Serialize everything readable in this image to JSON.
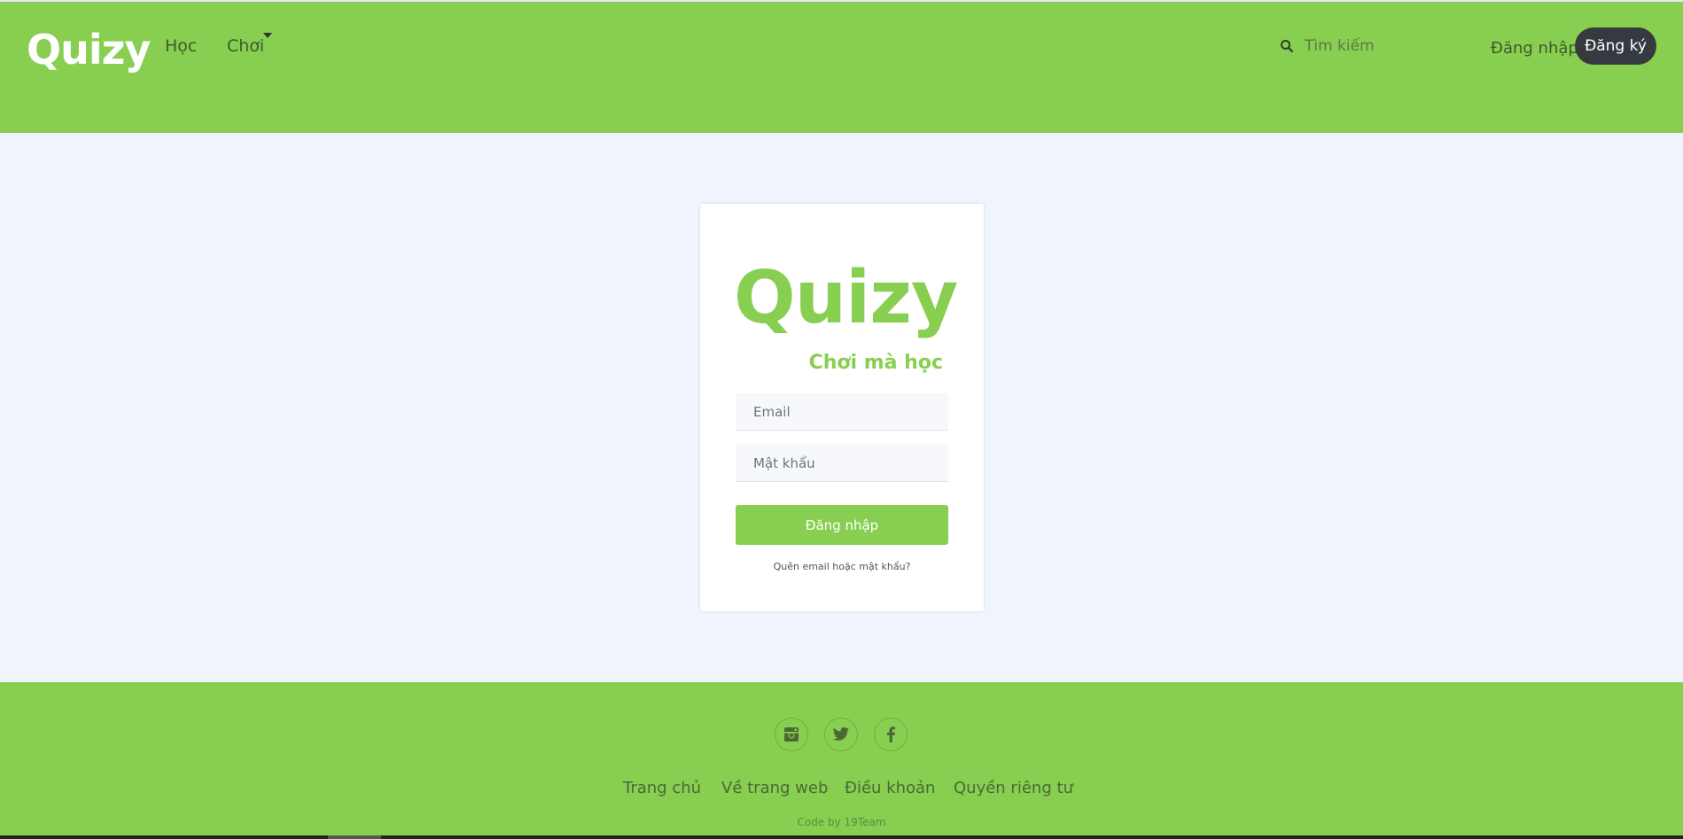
{
  "header": {
    "brand": "Quizy",
    "nav": [
      {
        "label": "Học"
      },
      {
        "label": "Chơi"
      }
    ],
    "search": {
      "placeholder": "Tìm kiếm"
    },
    "login_label": "Đăng nhập",
    "signup_label": "Đăng ký",
    "colors": {
      "background": "#88cf51",
      "signup_bg": "#343a40"
    }
  },
  "login_card": {
    "logo": "Quizy",
    "tagline": "Chơi mà học",
    "email_placeholder": "Email",
    "password_placeholder": "Mật khẩu",
    "submit_label": "Đăng nhập",
    "forgot_label": "Quên email hoặc mật khẩu?",
    "accent_color": "#88cf51"
  },
  "footer": {
    "social": [
      {
        "icon": "instagram-icon"
      },
      {
        "icon": "twitter-icon"
      },
      {
        "icon": "facebook-icon"
      }
    ],
    "links": [
      {
        "label": "Trang chủ"
      },
      {
        "label": "Về trang web"
      },
      {
        "label": "Điều khoản"
      },
      {
        "label": "Quyền riêng tư"
      }
    ],
    "credit": "Code by 19Team"
  }
}
